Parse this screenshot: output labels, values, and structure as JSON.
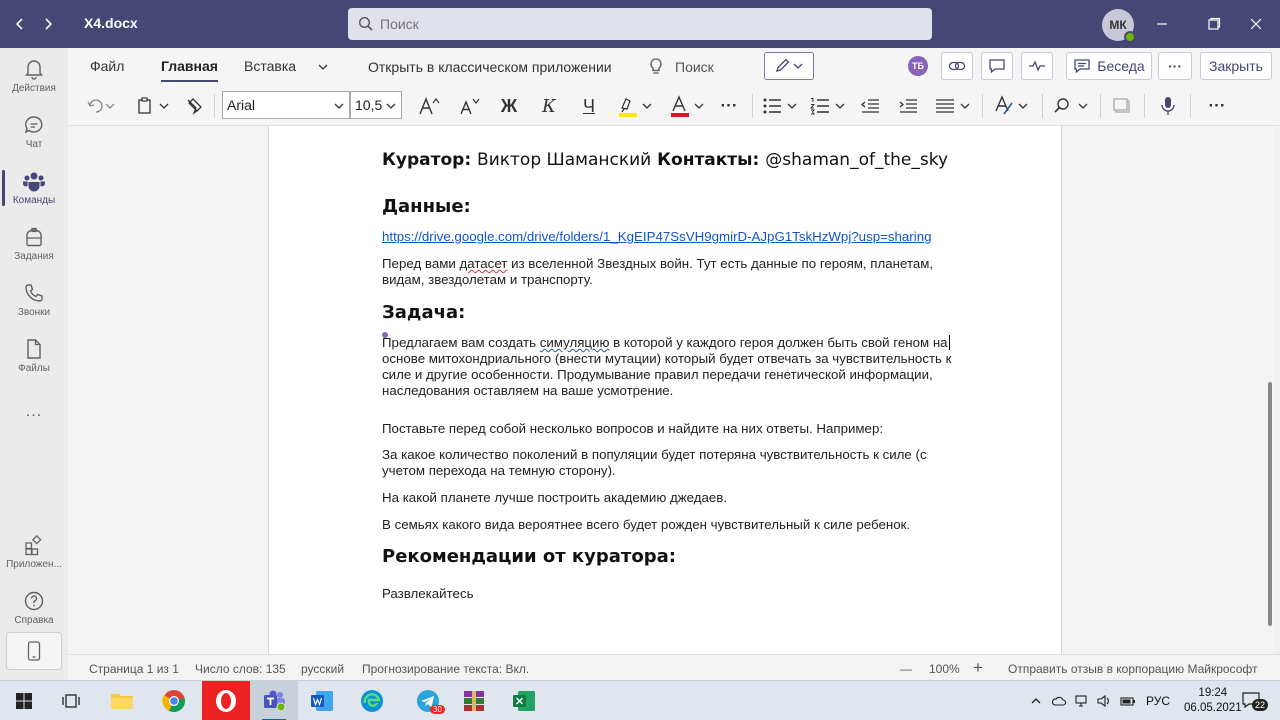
{
  "app": {
    "doc_title": "X4.docx",
    "search_placeholder": "Поиск",
    "avatar_initials": "МК"
  },
  "sidebar": {
    "items": [
      {
        "label": "Действия",
        "icon": "bell-icon"
      },
      {
        "label": "Чат",
        "icon": "chat-icon"
      },
      {
        "label": "Команды",
        "icon": "teams-icon"
      },
      {
        "label": "Задания",
        "icon": "assignments-icon"
      },
      {
        "label": "Звонки",
        "icon": "phone-icon"
      },
      {
        "label": "Файлы",
        "icon": "file-icon"
      },
      {
        "label": "...",
        "icon": "more-icon"
      },
      {
        "label": "Приложен...",
        "icon": "apps-icon"
      },
      {
        "label": "Справка",
        "icon": "help-icon"
      }
    ]
  },
  "ribbon": {
    "tabs": [
      "Файл",
      "Главная",
      "Вставка"
    ],
    "open_desktop": "Открыть в классическом приложении",
    "search_label": "Поиск",
    "user_badge": "ТБ",
    "chat_label": "Беседа",
    "close_label": "Закрыть",
    "font_name": "Arial",
    "font_size": "10,5",
    "bold": "Ж",
    "italic": "К",
    "underline": "Ч",
    "more": "···"
  },
  "document": {
    "curator_label": "Куратор:",
    "curator_name": "Виктор Шаманский",
    "contacts_label": "Контакты:",
    "contacts_value": "@shaman_of_the_sky",
    "data_heading": "Данные:",
    "data_link": "https://drive.google.com/drive/folders/1_KgEIP47SsVH9gmirD-AJpG1TskHzWpj?usp=sharing",
    "data_p_1": "Перед вами ",
    "data_p_word": "датасет",
    "data_p_2": " из вселенной Звездных войн. Тут есть данные по героям, планетам,",
    "data_p_3": "видам, звездолетам и транспорту.",
    "task_heading": "Задача:",
    "task_p_1": "Предлагаем вам создать ",
    "task_p_word": "симуляцию",
    "task_p_2": " в которой у каждого героя должен быть свой геном на",
    "task_p_3": "основе митохондриального (внести мутации) который будет отвечать за чувствительность к",
    "task_p_4": "силе и другие особенности. Продумывание правил передачи генетической информации,",
    "task_p_5": "наследования оставляем на ваше усмотрение.",
    "questions_intro": "Поставьте перед собой несколько вопросов и найдите на них ответы. Например:",
    "q1_a": "За какое количество поколений в популяции будет потеряна чувствительность к силе (с",
    "q1_b": "учетом перехода на темную сторону).",
    "q2": "На какой планете лучше построить академию джедаев.",
    "q3": "В семьях какого вида вероятнее всего будет рожден чувствительный к силе ребенок.",
    "rec_heading": "Рекомендации от куратора:",
    "rec_text": "Развлекайтесь"
  },
  "status": {
    "page": "Страница 1 из 1",
    "words": "Число слов: 135",
    "lang": "русский",
    "predict": "Прогнозирование текста: Вкл.",
    "zoom_minus": "—",
    "zoom": "100%",
    "zoom_plus": "+",
    "feedback": "Отправить отзыв в корпорацию Майкрософт"
  },
  "taskbar": {
    "tg_badge": "30",
    "lang": "РУС",
    "time": "19:24",
    "date": "06.05.2021",
    "notif_count": "22"
  }
}
